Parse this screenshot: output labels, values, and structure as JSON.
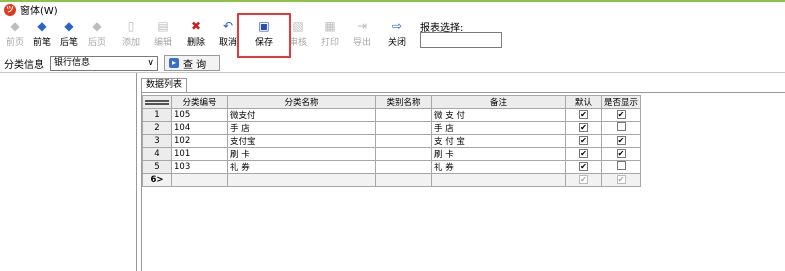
{
  "menu": {
    "window_label": "窗体(W)"
  },
  "toolbar": {
    "buttons": [
      {
        "label": "前页",
        "icon": "◆"
      },
      {
        "label": "前笔",
        "icon": "◆"
      },
      {
        "label": "后笔",
        "icon": "◆"
      },
      {
        "label": "后页",
        "icon": "◆"
      },
      {
        "label": "添加",
        "icon": "▯"
      },
      {
        "label": "编辑",
        "icon": "▤"
      },
      {
        "label": "删除",
        "icon": "✖"
      },
      {
        "label": "取消",
        "icon": "↶"
      },
      {
        "label": "保存",
        "icon": "▣"
      },
      {
        "label": "审核",
        "icon": "▧"
      },
      {
        "label": "打印",
        "icon": "▦"
      },
      {
        "label": "导出",
        "icon": "⇥"
      },
      {
        "label": "关闭",
        "icon": "⇨"
      }
    ],
    "report_select_label": "报表选择:",
    "report_select_value": ""
  },
  "filter": {
    "label": "分类信息",
    "selected": "银行信息",
    "query_button": "查 询"
  },
  "tab": {
    "label": "数据列表"
  },
  "grid": {
    "columns": [
      "分类编号",
      "分类名称",
      "类别名称",
      "备注",
      "默认",
      "是否显示"
    ],
    "rows": [
      {
        "num": "1",
        "code": "105",
        "name": "微支付",
        "category": "",
        "note": "微 支 付",
        "default": "✔",
        "show": "✔"
      },
      {
        "num": "2",
        "code": "104",
        "name": "手  店",
        "category": "",
        "note": "手   店",
        "default": "✔",
        "show": ""
      },
      {
        "num": "3",
        "code": "102",
        "name": "支付宝",
        "category": "",
        "note": "支 付 宝",
        "default": "✔",
        "show": "✔"
      },
      {
        "num": "4",
        "code": "101",
        "name": "刷  卡",
        "category": "",
        "note": "刷   卡",
        "default": "✔",
        "show": "✔"
      },
      {
        "num": "5",
        "code": "103",
        "name": "礼  券",
        "category": "",
        "note": "礼   券",
        "default": "✔",
        "show": ""
      }
    ],
    "new_row": {
      "num": "6>",
      "default": "✔",
      "show": "✔"
    }
  },
  "colors": {
    "highlight_box": "#e33b3b",
    "top_line": "#8fc24a"
  }
}
